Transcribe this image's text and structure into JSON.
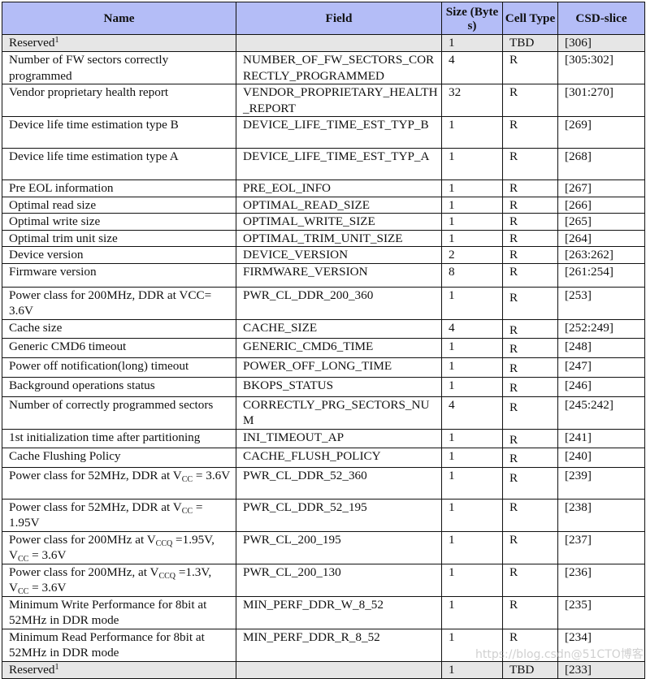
{
  "table": {
    "headers": {
      "name": "Name",
      "field": "Field",
      "size": "Size (Bytes)",
      "cell_type": "Cell Type",
      "csd_slice": "CSD-slice"
    },
    "rows": [
      {
        "name": "Reserved",
        "name_sup": "1",
        "field": "",
        "size": "1",
        "cell_type": "TBD",
        "csd_slice": "[306]",
        "reserved": true
      },
      {
        "name": "Number of FW sectors correctly programmed",
        "field": "NUMBER_OF_FW_SECTORS_CORRECTLY_PROGRAMMED",
        "size": "4",
        "cell_type": "R",
        "csd_slice": "[305:302]"
      },
      {
        "name": "Vendor proprietary health report",
        "field": "VENDOR_PROPRIETARY_HEALTH_REPORT",
        "size": "32",
        "cell_type": "R",
        "csd_slice": "[301:270]"
      },
      {
        "name": "Device life time estimation type B",
        "field": "DEVICE_LIFE_TIME_EST_TYP_B",
        "size": "1",
        "cell_type": "R",
        "csd_slice": "[269]"
      },
      {
        "name": "Device life time estimation type A",
        "field": "DEVICE_LIFE_TIME_EST_TYP_A",
        "size": "1",
        "cell_type": "R",
        "csd_slice": "[268]"
      },
      {
        "name": "Pre EOL information",
        "field": "PRE_EOL_INFO",
        "size": "1",
        "cell_type": "R",
        "csd_slice": "[267]"
      },
      {
        "name": "Optimal read size",
        "field": "OPTIMAL_READ_SIZE",
        "size": "1",
        "cell_type": "R",
        "csd_slice": "[266]"
      },
      {
        "name": "Optimal write size",
        "field": "OPTIMAL_WRITE_SIZE",
        "size": "1",
        "cell_type": "R",
        "csd_slice": "[265]"
      },
      {
        "name": "Optimal trim unit size",
        "field": "OPTIMAL_TRIM_UNIT_SIZE",
        "size": "1",
        "cell_type": "R",
        "csd_slice": "[264]"
      },
      {
        "name": "Device version",
        "field": "DEVICE_VERSION",
        "size": "2",
        "cell_type": "R",
        "csd_slice": "[263:262]"
      },
      {
        "name": "Firmware version",
        "field": "FIRMWARE_VERSION",
        "size": "8",
        "cell_type": "R",
        "csd_slice": "[261:254]"
      },
      {
        "name": "Power class for 200MHz, DDR at VCC= 3.6V",
        "field": "PWR_CL_DDR_200_360",
        "size": "1",
        "cell_type": "R",
        "csd_slice": "[253]"
      },
      {
        "name": "Cache size",
        "field": "CACHE_SIZE",
        "size": "4",
        "cell_type": "R",
        "csd_slice": "[252:249]"
      },
      {
        "name": "Generic CMD6 timeout",
        "field": "GENERIC_CMD6_TIME",
        "size": "1",
        "cell_type": "R",
        "csd_slice": "[248]"
      },
      {
        "name": "Power off notification(long) timeout",
        "field": "POWER_OFF_LONG_TIME",
        "size": "1",
        "cell_type": "R",
        "csd_slice": "[247]"
      },
      {
        "name": "Background operations status",
        "field": "BKOPS_STATUS",
        "size": "1",
        "cell_type": "R",
        "csd_slice": "[246]"
      },
      {
        "name": "Number of correctly programmed sectors",
        "field": "CORRECTLY_PRG_SECTORS_NUM",
        "size": "4",
        "cell_type": "R",
        "csd_slice": "[245:242]"
      },
      {
        "name": "1st initialization time after partitioning",
        "field": "INI_TIMEOUT_AP",
        "size": "1",
        "cell_type": "R",
        "csd_slice": "[241]"
      },
      {
        "name": "Cache Flushing Policy",
        "field": "CACHE_FLUSH_POLICY",
        "size": "1",
        "cell_type": "R",
        "csd_slice": "[240]"
      },
      {
        "name_parts": [
          "Power class for 52MHz, DDR at V",
          "CC",
          " = 3.6V"
        ],
        "field": "PWR_CL_DDR_52_360",
        "size": "1",
        "cell_type": "R",
        "csd_slice": "[239]"
      },
      {
        "name_parts": [
          "Power class for 52MHz, DDR at V",
          "CC",
          " = 1.95V"
        ],
        "field": "PWR_CL_DDR_52_195",
        "size": "1",
        "cell_type": "R",
        "csd_slice": "[238]"
      },
      {
        "name_parts": [
          "Power class for 200MHz  at V",
          "CCQ",
          " =1.95V, V",
          "CC",
          " = 3.6V"
        ],
        "field": "PWR_CL_200_195",
        "size": "1",
        "cell_type": "R",
        "csd_slice": "[237]"
      },
      {
        "name_parts": [
          "Power class for 200MHz, at V",
          "CCQ",
          " =1.3V, V",
          "CC",
          " = 3.6V"
        ],
        "field": "PWR_CL_200_130",
        "size": "1",
        "cell_type": "R",
        "csd_slice": "[236]"
      },
      {
        "name": "Minimum Write Performance for 8bit at 52MHz in DDR mode",
        "field": "MIN_PERF_DDR_W_8_52",
        "size": "1",
        "cell_type": "R",
        "csd_slice": "[235]"
      },
      {
        "name": "Minimum Read Performance for 8bit at 52MHz in DDR mode",
        "field": "MIN_PERF_DDR_R_8_52",
        "size": "1",
        "cell_type": "R",
        "csd_slice": "[234]"
      },
      {
        "name": "Reserved",
        "name_sup": "1",
        "field": "",
        "size": "1",
        "cell_type": "TBD",
        "csd_slice": "[233]",
        "reserved": true
      }
    ]
  },
  "watermark": "https://blog.csdn@51CTO博客"
}
